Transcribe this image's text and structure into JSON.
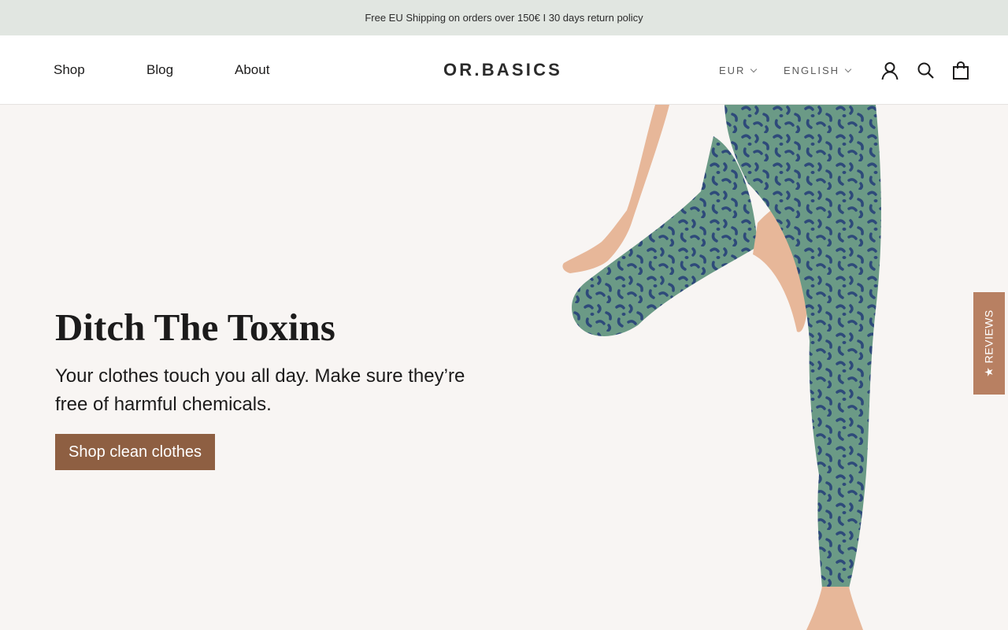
{
  "announcement": {
    "text": "Free EU Shipping on orders over 150€ I 30 days return policy"
  },
  "header": {
    "nav": [
      {
        "label": "Shop"
      },
      {
        "label": "Blog"
      },
      {
        "label": "About"
      }
    ],
    "logo": "OR.BASICS",
    "currency": {
      "label": "EUR"
    },
    "language": {
      "label": "ENGLISH"
    },
    "icons": [
      "account-icon",
      "search-icon",
      "cart-icon"
    ]
  },
  "hero": {
    "headline": "Ditch The Toxins",
    "subtext": "Your clothes touch you all day. Make sure  they’re free of harmful chemicals.",
    "cta_label": "Shop clean clothes"
  },
  "reviews_tab": {
    "label": "★ REVIEWS"
  },
  "colors": {
    "announcement_bg": "#e1e6e1",
    "hero_bg": "#f8f5f3",
    "cta_bg": "#8e5f42",
    "reviews_bg": "#b88062",
    "legging_green": "#6b9a86",
    "legging_spots": "#2e4a7a"
  }
}
